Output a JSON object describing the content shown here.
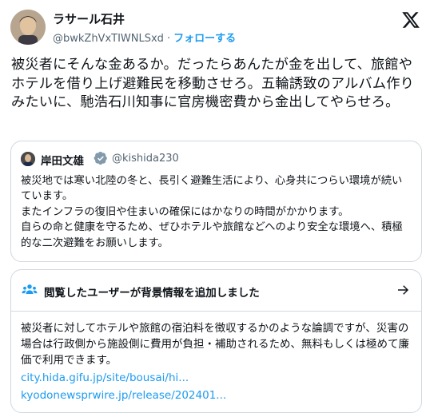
{
  "tweet": {
    "author_name": "ラサール石井",
    "author_handle": "@bwkZhVxTIWNLSxd",
    "separator": "·",
    "follow_label": "フォローする",
    "text": "被災者にそんな金あるか。だったらあんたが金を出して、旅館やホテルを借り上げ避難民を移動させろ。五輪誘致のアルバム作りみたいに、馳浩石川知事に官房機密費から金出してやらせろ。"
  },
  "quoted": {
    "author_name": "岸田文雄",
    "author_handle": "@kishida230",
    "text_lines": [
      "被災地では寒い北陸の冬と、長引く避難生活により、心身共につらい環境が続いています。",
      "またインフラの復旧や住まいの確保にはかなりの時間がかかります。",
      "自らの命と健康を守るため、ぜひホテルや旅館などへのより安全な環境へ、積極的な二次避難をお願いします。"
    ]
  },
  "community_note": {
    "title": "閲覧したユーザーが背景情報を追加しました",
    "body": "被災者に対してホテルや旅館の宿泊料を徴収するかのような論調ですが、災害の場合は行政側から施設側に費用が負担・補助されるため、無料もしくは極めて廉価で利用できます。",
    "links": [
      "city.hida.gifu.jp/site/bousai/hi...",
      "kyodonewsprwire.jp/release/202401..."
    ]
  },
  "icons": {
    "logo": "x-logo-icon",
    "verified": "verified-badge-icon",
    "note": "people-icon",
    "arrow": "arrow-right-icon"
  },
  "colors": {
    "accent": "#1d9bf0",
    "text": "#0f1419",
    "secondary": "#536471",
    "border": "#cfd9de"
  }
}
